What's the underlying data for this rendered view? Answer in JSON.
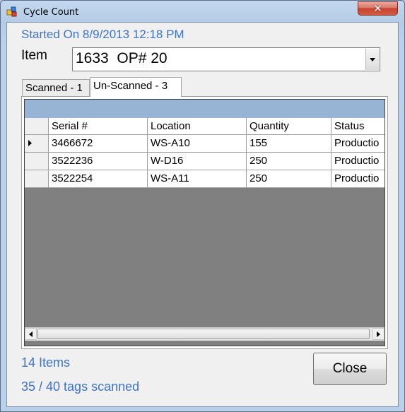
{
  "window": {
    "title": "Cycle Count",
    "close_glyph": "✕"
  },
  "header": {
    "started_on": "Started On 8/9/2013 12:18 PM",
    "item_label": "Item",
    "item_value": "1633  OP# 20"
  },
  "tabs": [
    {
      "label": "Scanned - 1",
      "active": false
    },
    {
      "label": "Un-Scanned - 3",
      "active": true
    }
  ],
  "grid": {
    "columns": [
      "Serial #",
      "Location",
      "Quantity",
      "Status"
    ],
    "rows": [
      [
        "3466672",
        "WS-A10",
        "155",
        "Productio"
      ],
      [
        "3522236",
        "W-D16",
        "250",
        "Productio"
      ],
      [
        "3522254",
        "WS-A11",
        "250",
        "Productio"
      ]
    ],
    "current_row": 0
  },
  "footer": {
    "items_count": "14 Items",
    "tags_scanned": "35 / 40 tags scanned",
    "close_label": "Close"
  },
  "colors": {
    "accent_text": "#3f74c4",
    "grid_caption": "#98b4d4",
    "grid_empty": "#808080"
  },
  "icons": [
    "app-icon",
    "close-window-icon",
    "dropdown-arrow-icon",
    "row-pointer-icon",
    "scroll-left-icon",
    "scroll-right-icon"
  ]
}
